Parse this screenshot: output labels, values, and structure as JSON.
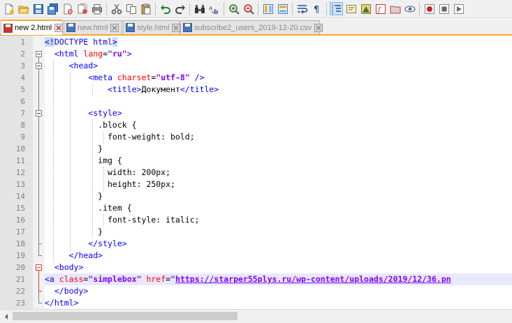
{
  "toolbar": {
    "icons": [
      "new-file-icon",
      "open-file-icon",
      "save-icon",
      "save-all-icon",
      "close-file-icon",
      "close-all-icon",
      "print-icon",
      "cut-icon",
      "copy-icon",
      "paste-icon",
      "undo-icon",
      "redo-icon",
      "find-icon",
      "replace-icon",
      "zoom-in-icon",
      "zoom-out-icon",
      "sync-vertical-icon",
      "sync-horizontal-icon",
      "word-wrap-icon",
      "show-all-chars-icon",
      "indent-guide-icon",
      "user-language-icon",
      "document-map-icon",
      "function-list-icon",
      "folder-workspace-icon",
      "monitoring-icon",
      "record-macro-icon",
      "stop-record-icon",
      "play-macro-icon"
    ]
  },
  "tabs": [
    {
      "label": "new 2.html",
      "active": true
    },
    {
      "label": "new.html",
      "active": false
    },
    {
      "label": "style.html",
      "active": false
    },
    {
      "label": "subscribe2_users_2019-12-20.csv",
      "active": false
    }
  ],
  "editor": {
    "line_numbers": [
      "1",
      "2",
      "3",
      "4",
      "5",
      "6",
      "7",
      "8",
      "9",
      "10",
      "11",
      "12",
      "13",
      "14",
      "15",
      "16",
      "17",
      "18",
      "19",
      "20",
      "21",
      "22",
      "23"
    ],
    "lines": [
      [
        {
          "t": "<!",
          "c": "tag hl"
        },
        {
          "t": "DOCTYPE html",
          "c": "tag"
        },
        {
          "t": ">",
          "c": "tag hl"
        }
      ],
      [
        {
          "t": "  <html ",
          "c": "tag"
        },
        {
          "t": "lang",
          "c": "attr"
        },
        {
          "t": "=",
          "c": "text"
        },
        {
          "t": "\"ru\"",
          "c": "str"
        },
        {
          "t": ">",
          "c": "tag"
        }
      ],
      [
        {
          "t": "     <head>",
          "c": "tag"
        }
      ],
      [
        {
          "t": "         <meta ",
          "c": "tag"
        },
        {
          "t": "charset",
          "c": "attr"
        },
        {
          "t": "=",
          "c": "text"
        },
        {
          "t": "\"utf-8\"",
          "c": "str"
        },
        {
          "t": " />",
          "c": "tag"
        }
      ],
      [
        {
          "t": "             <title>",
          "c": "tag"
        },
        {
          "t": "Документ",
          "c": "text"
        },
        {
          "t": "</title>",
          "c": "tag"
        }
      ],
      [],
      [
        {
          "t": "         <style>",
          "c": "tag"
        }
      ],
      [
        {
          "t": "           .block {",
          "c": "text"
        }
      ],
      [
        {
          "t": "             font-weight: bold;",
          "c": "text"
        }
      ],
      [
        {
          "t": "           }",
          "c": "text"
        }
      ],
      [
        {
          "t": "           img {",
          "c": "text"
        }
      ],
      [
        {
          "t": "             width: 200px;",
          "c": "text"
        }
      ],
      [
        {
          "t": "             height: 250px;",
          "c": "text"
        }
      ],
      [
        {
          "t": "           }",
          "c": "text"
        }
      ],
      [
        {
          "t": "           .item {",
          "c": "text"
        }
      ],
      [
        {
          "t": "             font-style: italic;",
          "c": "text"
        }
      ],
      [
        {
          "t": "           }",
          "c": "text"
        }
      ],
      [
        {
          "t": "         </style>",
          "c": "tag"
        }
      ],
      [
        {
          "t": "     </head>",
          "c": "tag"
        }
      ],
      [
        {
          "t": "  <body>",
          "c": "tag"
        }
      ],
      [
        {
          "t": "<a ",
          "c": "tag"
        },
        {
          "t": "class",
          "c": "attr"
        },
        {
          "t": "=",
          "c": "text"
        },
        {
          "t": "\"simplebox\"",
          "c": "str"
        },
        {
          "t": " ",
          "c": "text"
        },
        {
          "t": "href",
          "c": "attr"
        },
        {
          "t": "=",
          "c": "text"
        },
        {
          "t": "\"",
          "c": "str"
        },
        {
          "t": "https://starper55plys.ru/wp-content/uploads/2019/12/36.pn",
          "c": "url"
        }
      ],
      [
        {
          "t": "  </body>",
          "c": "tag"
        }
      ],
      [
        {
          "t": "</html>",
          "c": "tag"
        }
      ]
    ],
    "current_line": 21
  },
  "colors": {
    "tag": "#0000ff",
    "attr": "#ff0000",
    "string": "#8000ff",
    "tab_accent": "#f9a52f",
    "gutter": "#e4e4e4",
    "current_line": "#e8e8ff"
  }
}
